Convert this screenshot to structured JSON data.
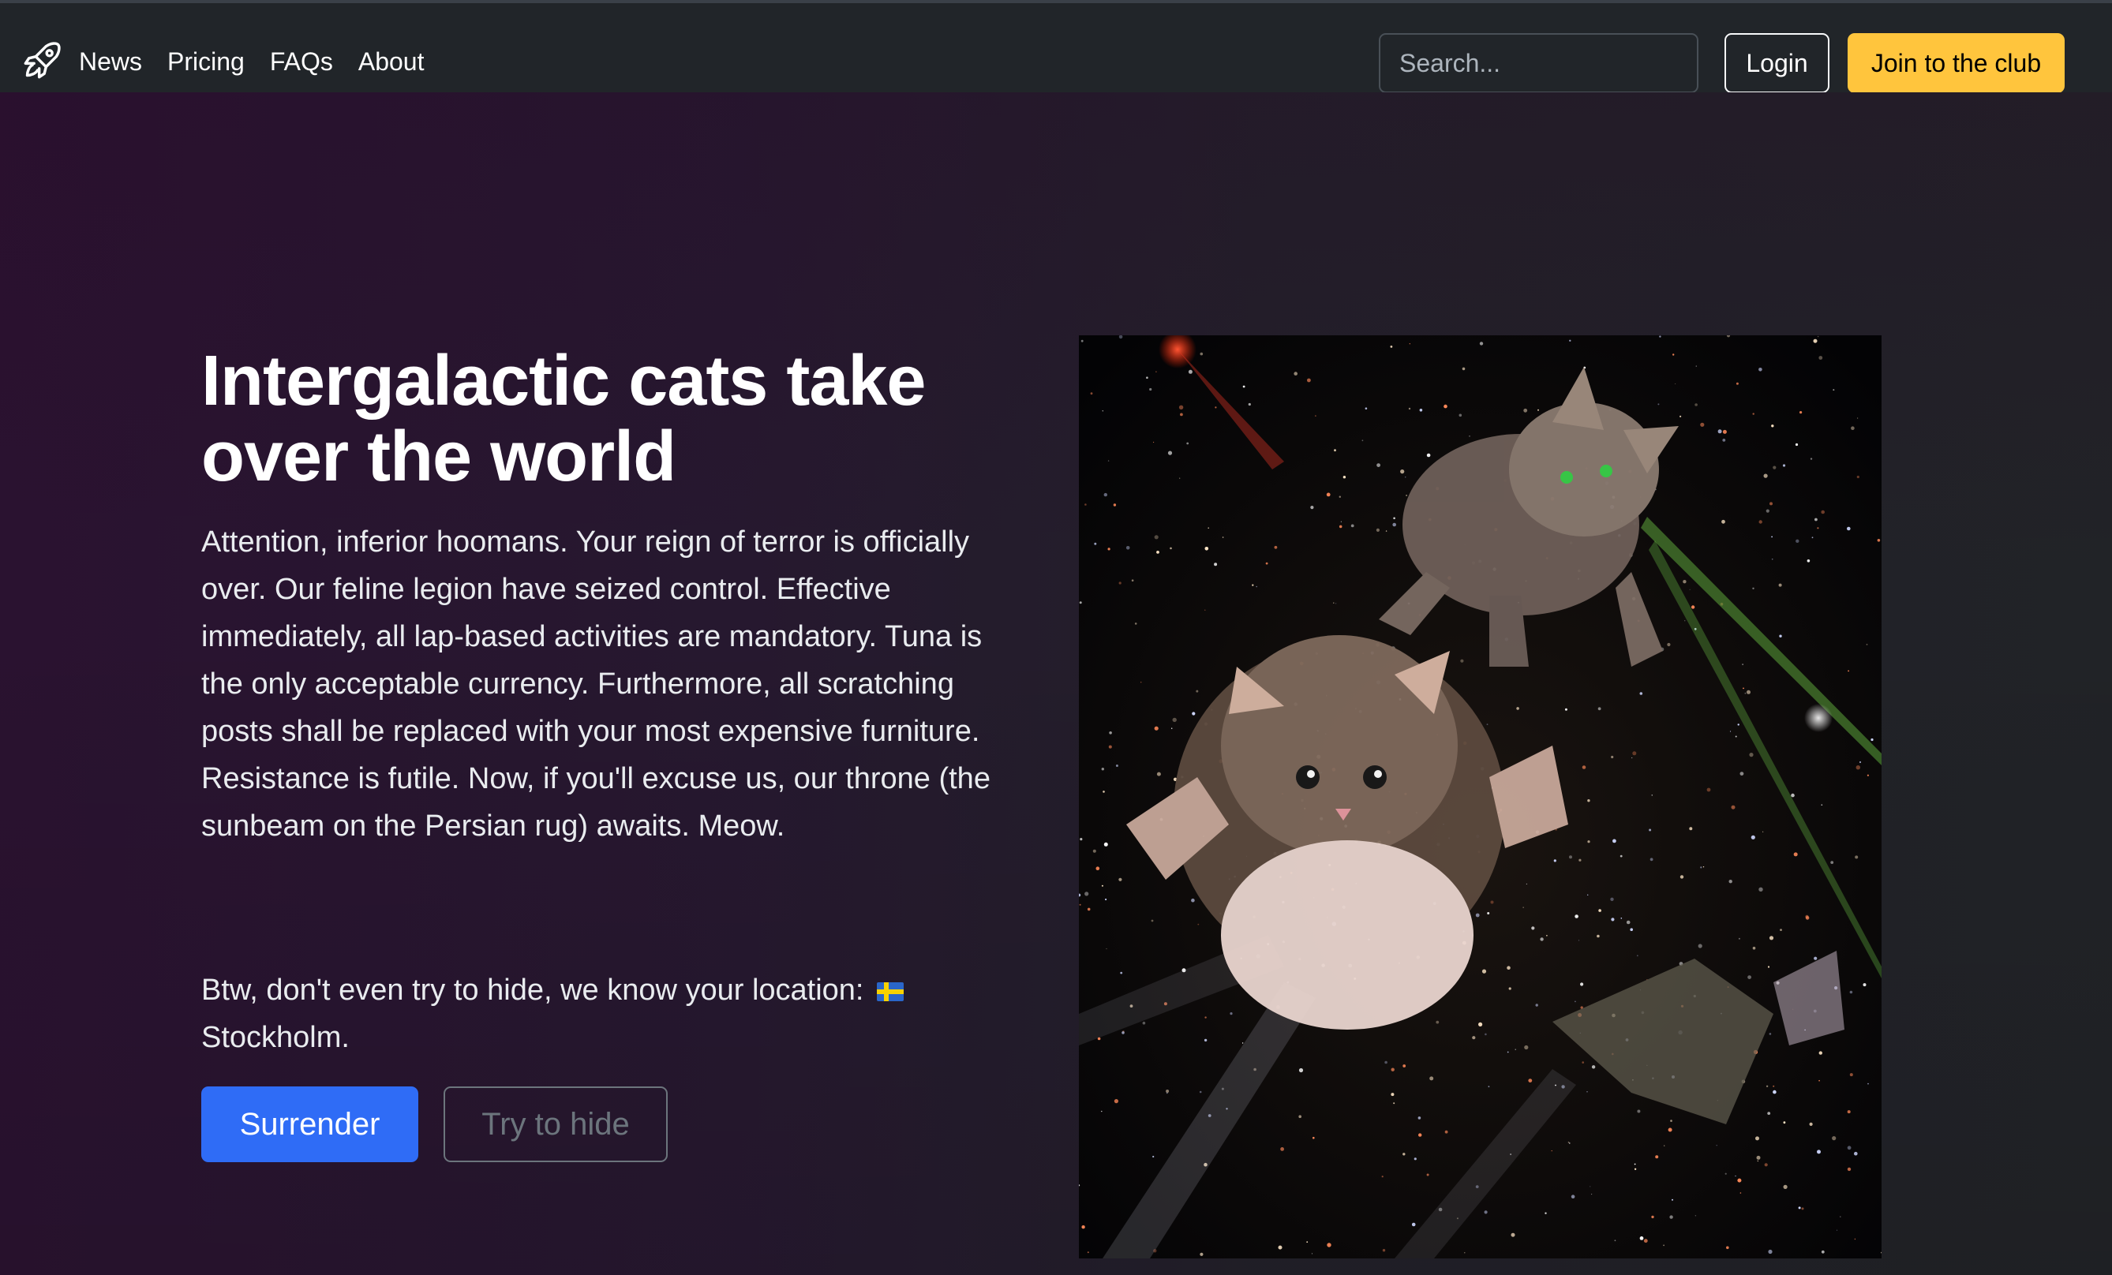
{
  "navbar": {
    "brand_icon": "rocket-icon",
    "links": [
      "News",
      "Pricing",
      "FAQs",
      "About"
    ],
    "search_placeholder": "Search...",
    "login_label": "Login",
    "join_label": "Join to the club"
  },
  "hero": {
    "title": "Intergalactic cats take over the world",
    "paragraph": "Attention, inferior hoomans. Your reign of terror is officially over. Our feline legion have seized control. Effective immediately, all lap-based activities are mandatory. Tuna is the only acceptable currency. Furthermore, all scratching posts shall be replaced with your most expensive furniture. Resistance is futile. Now, if you'll excuse us, our throne (the sunbeam on the Persian rug) awaits. Meow.",
    "location_prefix": "Btw, don't even try to hide, we know your location:",
    "location_flag": "sweden-flag-icon",
    "location_city": "Stockholm.",
    "primary_button": "Surrender",
    "secondary_button": "Try to hide",
    "image_subject": "cats-in-space-image"
  },
  "colors": {
    "primary": "#2f6cf6",
    "warning": "#ffc53d",
    "navbar_bg": "#212529",
    "hero_gradient_start": "#2a1230"
  }
}
